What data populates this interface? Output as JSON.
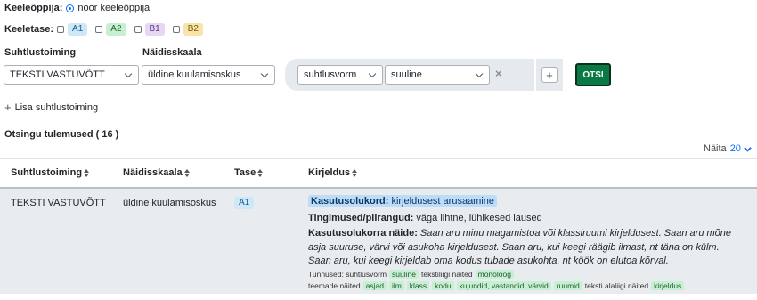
{
  "filters": {
    "learner_label": "Keeleõppija:",
    "learner_option": "noor keeleõppija",
    "level_label": "Keeletase:",
    "levels": [
      "A1",
      "A2",
      "B1",
      "B2"
    ]
  },
  "form": {
    "activity_label": "Suhtlustoiming",
    "scale_label": "Näidisskaala",
    "activity_value": "TEKSTI VASTUVÕTT",
    "scale_value": "üldine kuulamisoskus",
    "attr_value": "suhtlusvorm",
    "attr_sub_value": "suuline",
    "remove_symbol": "×",
    "add_symbol": "+",
    "search_button": "OTSI",
    "add_activity": "Lisa suhtlustoiming",
    "add_activity_symbol": "+"
  },
  "results": {
    "title": "Otsingu tulemused ( 16 )",
    "per_page_label": "Näita",
    "per_page_value": "20",
    "columns": [
      "Suhtlustoiming",
      "Näidisskaala",
      "Tase",
      "Kirjeldus"
    ]
  },
  "row": {
    "activity": "TEKSTI VASTUVÕTT",
    "scale": "üldine kuulamisoskus",
    "level": "A1",
    "situation_label": "Kasutusolukord:",
    "situation_value": "kirjeldusest arusaamine",
    "conditions_label": "Tingimused/piirangud:",
    "conditions_value": "väga lihtne, lühikesed laused",
    "examples_label": "Kasutusolukorra näide:",
    "examples_text": "Saan aru minu magamistoa või klassiruumi kirjeldusest. Saan aru mõne asja suuruse, värvi või asukoha kirjeldusest. Saan aru, kui keegi räägib ilmast, nt täna on külm. Saan aru, kui keegi kirjeldab oma kodus tubade asukohta, nt köök on elutoa kõrval.",
    "features_prefix": "Tunnused: suhtlusvorm",
    "features_tag1": "suuline",
    "features_mid": "tekstiliigi näited",
    "features_tag2": "monoloog",
    "topics_prefix": "teemade näited",
    "topics": [
      "asjad",
      "ilm",
      "klass",
      "kodu",
      "kujundid, vastandid, värvid",
      "ruumid"
    ],
    "text_type_prefix": "teksti alaliigi näited",
    "text_type_tag": "kirjeldus"
  }
}
